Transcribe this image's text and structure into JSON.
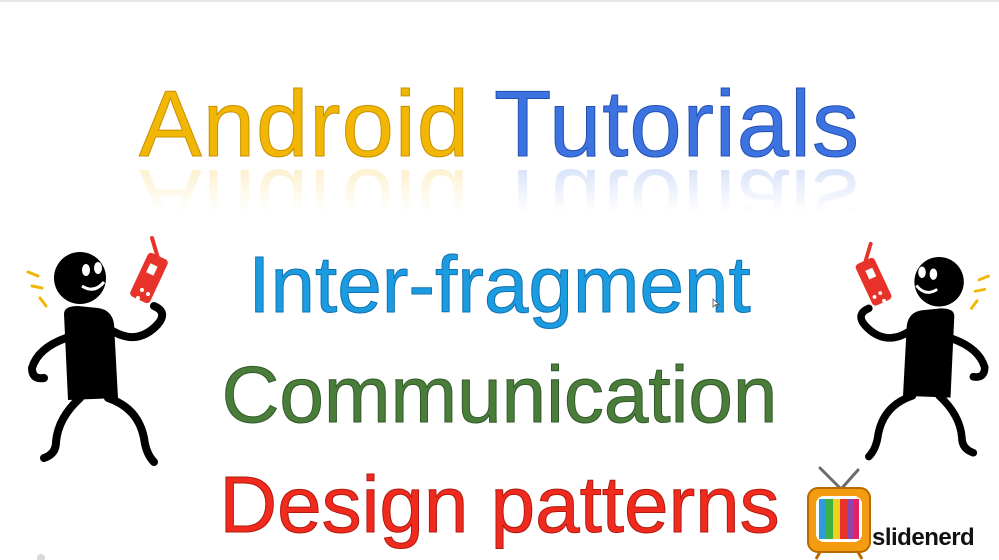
{
  "slide": {
    "title_word_1": "Android",
    "title_word_2": "Tutorials",
    "line_1": "Inter-fragment",
    "line_2": "Communication",
    "line_3": "Design patterns"
  },
  "brand": {
    "logo_text": "slidenerd"
  },
  "colors": {
    "title_word_1": "#f2b705",
    "title_word_2": "#3d73e0",
    "line_1": "#1b9be0",
    "line_2": "#4a7d3a",
    "line_3": "#f02a1c",
    "phone": "#e8332a"
  },
  "icons": {
    "figure_left": "stick-figure-phone-icon",
    "figure_right": "stick-figure-phone-icon",
    "logo": "retro-tv-icon",
    "cursor": "mouse-cursor-icon"
  }
}
